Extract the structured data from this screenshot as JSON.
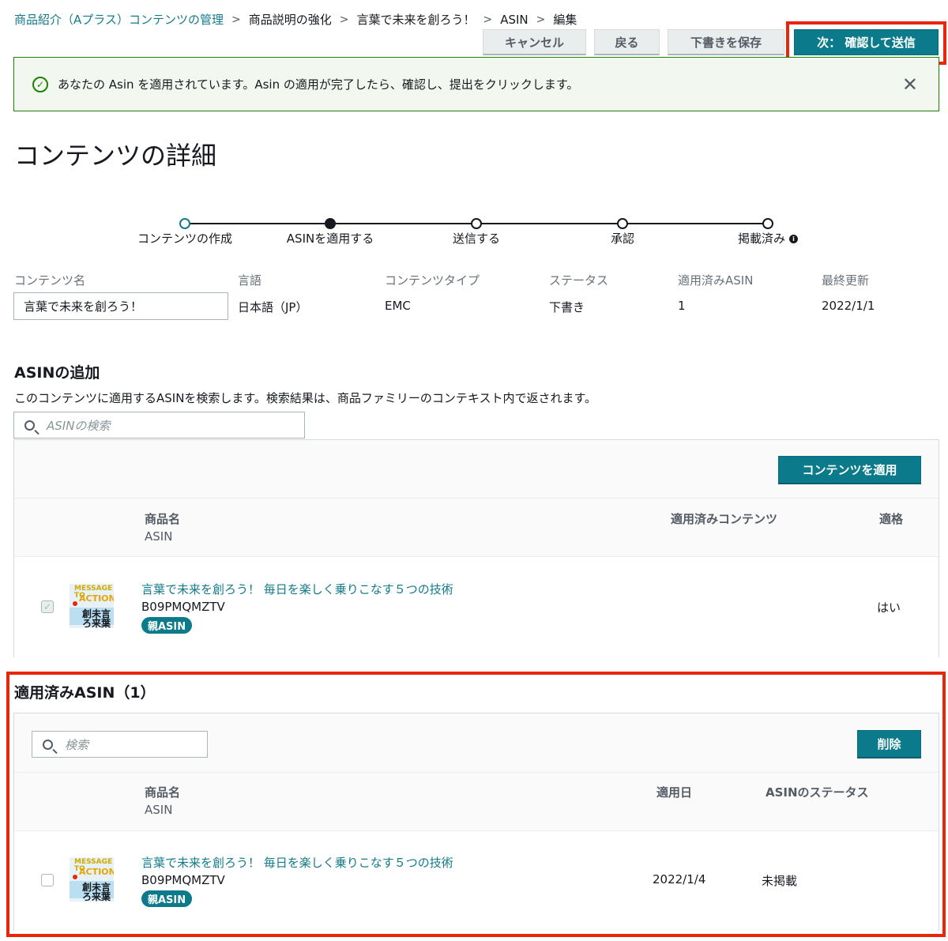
{
  "breadcrumb": {
    "items": [
      "商品紹介（Aプラス）コンテンツの管理",
      "商品説明の強化",
      "言葉で未来を創ろう！",
      "ASIN",
      "編集"
    ]
  },
  "actions": {
    "cancel": "キャンセル",
    "back": "戻る",
    "save_draft": "下書きを保存",
    "next": "次： 確認して送信"
  },
  "flash": {
    "message": "あなたの Asin を適用されています。Asin の適用が完了したら、確認し、提出をクリックします。",
    "close_glyph": "✕"
  },
  "page": {
    "title": "コンテンツの詳細"
  },
  "steps": [
    {
      "label": "コンテンツの作成",
      "state": "done"
    },
    {
      "label": "ASINを適用する",
      "state": "current"
    },
    {
      "label": "送信する",
      "state": "todo"
    },
    {
      "label": "承認",
      "state": "todo"
    },
    {
      "label": "掲載済み",
      "state": "todo"
    }
  ],
  "meta": {
    "content_name_label": "コンテンツ名",
    "content_name": "言葉で未来を創ろう！",
    "language_label": "言語",
    "language": "日本語（JP）",
    "content_type_label": "コンテンツタイプ",
    "content_type": "EMC",
    "status_label": "ステータス",
    "status": "下書き",
    "applied_asin_label": "適用済みASIN",
    "applied_asin": "1",
    "last_updated_label": "最終更新",
    "last_updated": "2022/1/1"
  },
  "add_asin": {
    "heading": "ASINの追加",
    "description": "このコンテンツに適用するASINを検索します。検索結果は、商品ファミリーのコンテキスト内で返されます。",
    "search_placeholder": "ASINの検索",
    "apply_button": "コンテンツを適用",
    "columns": {
      "product": "商品名",
      "asin": "ASIN",
      "applied": "適用済みコンテンツ",
      "eligible": "適格"
    },
    "rows": [
      {
        "title": "言葉で未来を創ろう！ 毎日を楽しく乗りこなす５つの技術",
        "asin": "B09PMQMZTV",
        "badge": "親ASIN",
        "eligible": "はい",
        "checked": true
      }
    ]
  },
  "applied": {
    "heading": "適用済みASIN（1）",
    "search_placeholder": "検索",
    "delete_button": "削除",
    "columns": {
      "product": "商品名",
      "asin": "ASIN",
      "applied_date": "適用日",
      "asin_status": "ASINのステータス"
    },
    "rows": [
      {
        "title": "言葉で未来を創ろう！ 毎日を楽しく乗りこなす５つの技術",
        "asin": "B09PMQMZTV",
        "badge": "親ASIN",
        "date": "2022/1/4",
        "status": "未掲載",
        "checked": false
      }
    ]
  },
  "thumbnail": {
    "line1": "MESSAGE TO",
    "line2": "ACTION",
    "line3": "創未言 ろ来葉"
  },
  "colors": {
    "accent": "#0b7a8a",
    "highlight": "#e8260b",
    "success": "#1d8102"
  }
}
